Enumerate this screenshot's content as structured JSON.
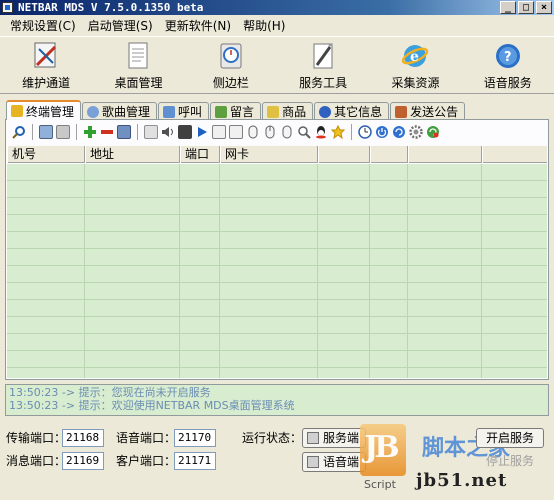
{
  "window": {
    "title": "NETBAR MDS V 7.5.0.1350 beta",
    "min": "_",
    "max": "□",
    "close": "×"
  },
  "menu": [
    "常规设置(C)",
    "启动管理(S)",
    "更新软件(N)",
    "帮助(H)"
  ],
  "big_toolbar": [
    {
      "label": "维护通道",
      "icon": "maintenance-icon"
    },
    {
      "label": "桌面管理",
      "icon": "desktop-icon"
    },
    {
      "label": "侧边栏",
      "icon": "sidebar-icon"
    },
    {
      "label": "服务工具",
      "icon": "tools-icon"
    },
    {
      "label": "采集资源",
      "icon": "ie-globe-icon"
    },
    {
      "label": "语音服务",
      "icon": "voice-help-icon"
    }
  ],
  "tabs": [
    {
      "label": "终端管理",
      "color": "#e6b422"
    },
    {
      "label": "歌曲管理",
      "color": "#7aa0d8"
    },
    {
      "label": "呼叫",
      "color": "#6090d0"
    },
    {
      "label": "留言",
      "color": "#5ca040"
    },
    {
      "label": "商品",
      "color": "#e0c040"
    },
    {
      "label": "其它信息",
      "color": "#3060c0"
    },
    {
      "label": "发送公告",
      "color": "#c06030"
    }
  ],
  "columns": [
    "机号",
    "地址",
    "端口",
    "网卡"
  ],
  "log": [
    "13:50:23 -> 提示：您现在尚未开启服务",
    "13:50:23 -> 提示：欢迎使用NETBAR MDS桌面管理系统"
  ],
  "ports": {
    "transfer_label": "传输端口：",
    "transfer_value": "21168",
    "voice_label": "语音端口：",
    "voice_value": "21170",
    "message_label": "消息端口：",
    "message_value": "21169",
    "client_label": "客户端口：",
    "client_value": "21171"
  },
  "status": {
    "label": "运行状态：",
    "service_btn": "服务端",
    "voice_btn": "语音端",
    "start_btn": "开启服务",
    "stop_btn": "停止服务"
  },
  "watermark": {
    "script": "Script",
    "cn": "脚本之家",
    "url": "jb51.net"
  }
}
